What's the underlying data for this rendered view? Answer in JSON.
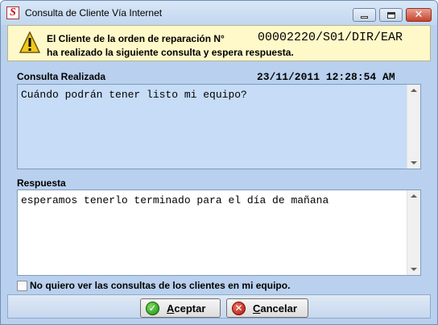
{
  "window": {
    "title": "Consulta de Cliente Vía Internet",
    "icon": "app-logo-icon",
    "controls": [
      "minimize-icon",
      "maximize-icon",
      "close-icon"
    ]
  },
  "banner": {
    "icon": "warning-icon",
    "line1": "El Cliente de la orden de reparación N°",
    "order_number": "00002220/S01/DIR/EAR",
    "line2": "ha realizado la siguiente consulta y espera respuesta."
  },
  "query": {
    "label": "Consulta Realizada",
    "datetime": "23/11/2011 12:28:54 AM",
    "text": "Cuándo podrán tener listo mi equipo?"
  },
  "response": {
    "label": "Respuesta",
    "text": "esperamos tenerlo terminado para el día de mañana"
  },
  "option": {
    "label": "No quiero ver las consultas de los clientes en mi equipo.",
    "checked": false
  },
  "buttons": {
    "accept_mnemonic": "A",
    "accept_rest": "ceptar",
    "accept_icon": "check-icon",
    "cancel_mnemonic": "C",
    "cancel_rest": "ancelar",
    "cancel_icon": "cancel-x-icon"
  },
  "colors": {
    "query_bg": "#c6dcf7",
    "response_bg": "#ffffff",
    "banner_bg": "#fff8c8",
    "window_bg": "#b9d0ee"
  }
}
